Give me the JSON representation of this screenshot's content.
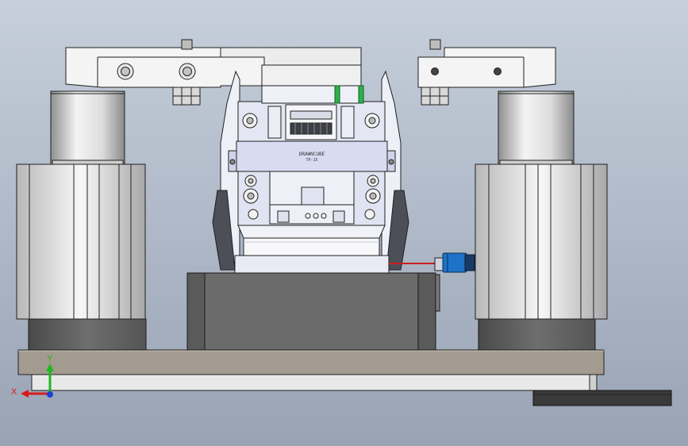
{
  "viewport": {
    "background_top": "#c6cfdb",
    "background_bottom": "#98a3b4"
  },
  "part_label": {
    "line1": "DRAWNCUBE",
    "line2": "TP-15"
  },
  "triad": {
    "x_label": "X",
    "y_label": "Y",
    "x_color": "#d91a1a",
    "y_color": "#1db81d",
    "z_color": "#1a3fd9"
  },
  "sensor": {
    "body_color": "#1e73c8",
    "cable_color": "#c81e1e"
  },
  "colors": {
    "edge": "#202020",
    "cylinder_light": "#f2f2f2",
    "cylinder_dark": "#9a9a9a",
    "base_plate": "#a39b90",
    "block_dark": "#6b6b6b",
    "frame_blue": "#d8dcf2",
    "green_accent": "#2bb24c"
  }
}
